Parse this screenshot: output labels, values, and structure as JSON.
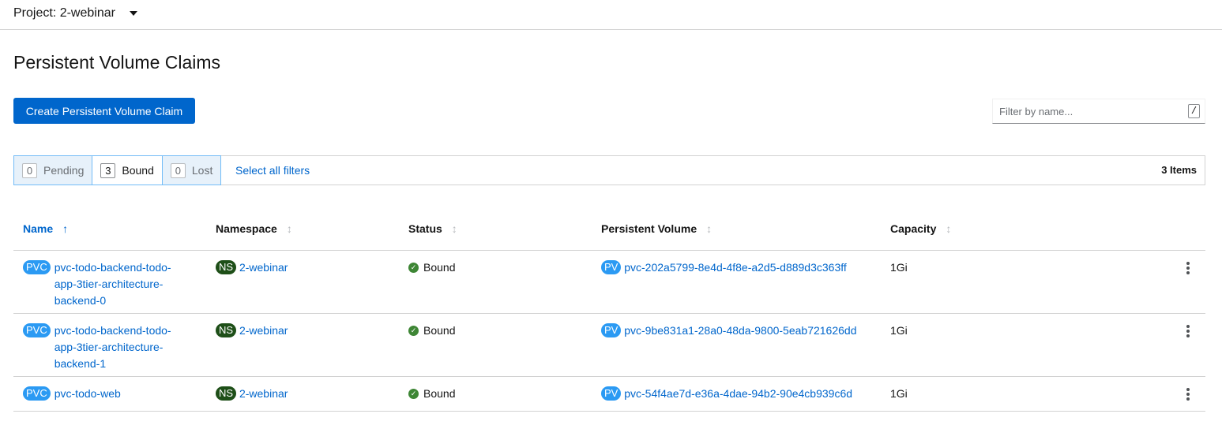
{
  "project": {
    "label": "Project: 2-webinar"
  },
  "page": {
    "title": "Persistent Volume Claims"
  },
  "toolbar": {
    "create_label": "Create Persistent Volume Claim",
    "filter_placeholder": "Filter by name...",
    "filter_shortcut": "/"
  },
  "status_filters": [
    {
      "count": "0",
      "label": "Pending",
      "active": false
    },
    {
      "count": "3",
      "label": "Bound",
      "active": true
    },
    {
      "count": "0",
      "label": "Lost",
      "active": false
    }
  ],
  "select_all_label": "Select all filters",
  "items_count": "3 Items",
  "table": {
    "headers": [
      "Name",
      "Namespace",
      "Status",
      "Persistent Volume",
      "Capacity"
    ],
    "sorted_column": "Name",
    "rows": [
      {
        "name_badge": "PVC",
        "name": "pvc-todo-backend-todo-app-3tier-architecture-backend-0",
        "namespace_badge": "NS",
        "namespace": "2-webinar",
        "status": "Bound",
        "pv_badge": "PV",
        "pv": "pvc-202a5799-8e4d-4f8e-a2d5-d889d3c363ff",
        "capacity": "1Gi"
      },
      {
        "name_badge": "PVC",
        "name": "pvc-todo-backend-todo-app-3tier-architecture-backend-1",
        "namespace_badge": "NS",
        "namespace": "2-webinar",
        "status": "Bound",
        "pv_badge": "PV",
        "pv": "pvc-9be831a1-28a0-48da-9800-5eab721626dd",
        "capacity": "1Gi"
      },
      {
        "name_badge": "PVC",
        "name": "pvc-todo-web",
        "namespace_badge": "NS",
        "namespace": "2-webinar",
        "status": "Bound",
        "pv_badge": "PV",
        "pv": "pvc-54f4ae7d-e36a-4dae-94b2-90e4cb939c6d",
        "capacity": "1Gi"
      }
    ]
  },
  "icons": {
    "project_dropdown": "caret-down-icon",
    "sort_active": "arrow-up-icon",
    "sort_inactive": "sort-icon",
    "status_ok": "check-circle-icon",
    "row_actions": "kebab-icon"
  },
  "colors": {
    "primary": "#0066cc",
    "pvc_badge": "#2b9af3",
    "ns_badge": "#1e4f18",
    "success": "#3e8635",
    "filter_chip_border": "#73bcf7"
  }
}
